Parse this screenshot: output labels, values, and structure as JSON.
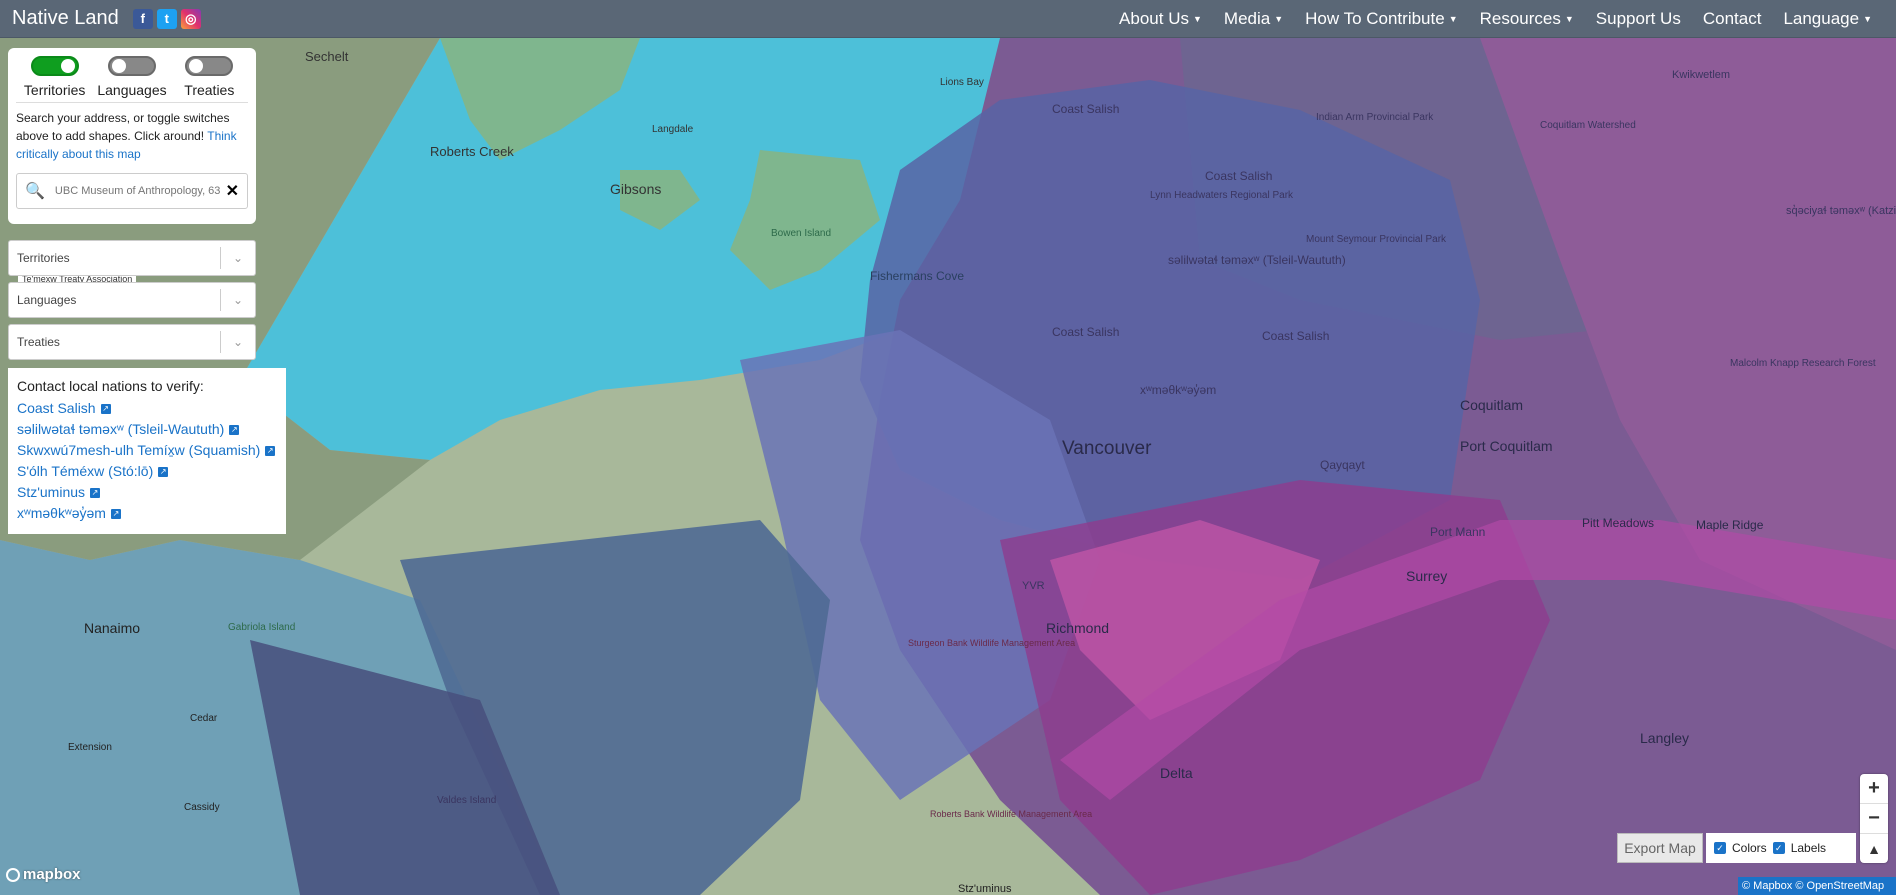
{
  "navbar": {
    "brand": "Native Land",
    "social": [
      "f",
      "t",
      "◎"
    ],
    "items": [
      {
        "label": "About Us",
        "dropdown": true
      },
      {
        "label": "Media",
        "dropdown": true
      },
      {
        "label": "How To Contribute",
        "dropdown": true
      },
      {
        "label": "Resources",
        "dropdown": true
      },
      {
        "label": "Support Us",
        "dropdown": false
      },
      {
        "label": "Contact",
        "dropdown": false
      },
      {
        "label": "Language",
        "dropdown": true
      }
    ],
    "colors": {
      "bar": "#5a6776"
    }
  },
  "panel": {
    "toggles": [
      {
        "label": "Territories",
        "on": true
      },
      {
        "label": "Languages",
        "on": false
      },
      {
        "label": "Treaties",
        "on": false
      }
    ],
    "instructions": "Search your address, or toggle switches above to add shapes. Click around!",
    "think_link": "Think critically about this map",
    "search_placeholder": "UBC Museum of Anthropology, 63"
  },
  "dropdowns": {
    "territories": "Territories",
    "languages": "Languages",
    "treaties": "Treaties",
    "chip": "Te'mexw Treaty Association"
  },
  "contact": {
    "heading": "Contact local nations to verify:",
    "nations": [
      "Coast Salish",
      "səlilwətaɬ təməxʷ (Tsleil-Waututh)",
      "Skwxwú7mesh-ulh Temíx̱w (Squamish)",
      "S'ólh Téméxw (Stó:lō)",
      "Stz'uminus",
      "xʷməθkʷəy̓əm"
    ]
  },
  "map": {
    "labels": {
      "sechelt": "Sechelt",
      "roberts_creek": "Roberts Creek",
      "langdale": "Langdale",
      "gibsons": "Gibsons",
      "bowen_island": "Bowen Island",
      "lions_bay": "Lions Bay",
      "fishermans_cove": "Fishermans Cove",
      "coast_salish_1": "Coast Salish",
      "coast_salish_2": "Coast Salish",
      "coast_salish_3": "Coast Salish",
      "coast_salish_4": "Coast Salish",
      "tsleil": "səlilwətaɬ təməxʷ (Tsleil-Waututh)",
      "indian_arm": "Indian Arm Provincial Park",
      "lynn": "Lynn Headwaters Regional Park",
      "seymour": "Mount Seymour Provincial Park",
      "coquitlam_watershed": "Coquitlam Watershed",
      "kwikwetlem": "Kwikwetlem",
      "katzie": "sq̓əciyaɬ təməxʷ (Katzie)",
      "malcolm": "Malcolm Knapp Research Forest",
      "vancouver": "Vancouver",
      "coquitlam": "Coquitlam",
      "port_coquitlam": "Port Coquitlam",
      "musqueam": "xʷməθkʷəy̓əm",
      "qayqayt": "Qayqayt",
      "port_mann": "Port Mann",
      "pitt_meadows": "Pitt Meadows",
      "maple_ridge": "Maple Ridge",
      "yvr": "YVR",
      "surrey": "Surrey",
      "richmond": "Richmond",
      "sturgeon": "Sturgeon Bank Wildlife Management Area",
      "nanaimo": "Nanaimo",
      "gabriola": "Gabriola Island",
      "cedar": "Cedar",
      "extension": "Extension",
      "cassidy": "Cassidy",
      "valdes": "Valdes Island",
      "delta": "Delta",
      "langley": "Langley",
      "roberts_bank": "Roberts Bank Wildlife Management Area",
      "stzuminus_map": "Stz'uminus"
    }
  },
  "controls": {
    "export_label": "Export Map",
    "colors_label": "Colors",
    "labels_label": "Labels",
    "zoom_in": "+",
    "zoom_out": "−",
    "compass": "▲"
  },
  "footer": {
    "mapbox": "mapbox",
    "attribution": "© Mapbox © OpenStreetMap"
  }
}
